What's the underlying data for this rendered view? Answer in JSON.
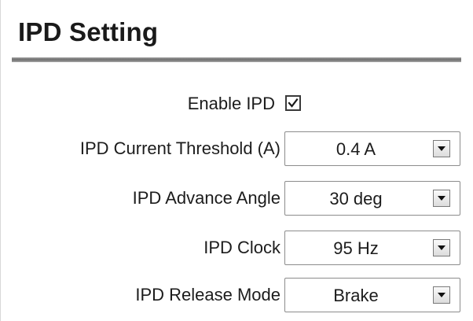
{
  "panel": {
    "title": "IPD Setting"
  },
  "enable": {
    "label": "Enable IPD",
    "checked": true
  },
  "settings": [
    {
      "label": "IPD Current Threshold (A)",
      "value": "0.4 A"
    },
    {
      "label": "IPD Advance Angle",
      "value": "30 deg"
    },
    {
      "label": "IPD Clock",
      "value": "95 Hz"
    },
    {
      "label": "IPD Release Mode",
      "value": "Brake"
    }
  ],
  "icons": {
    "checkbox": "check-icon",
    "dropdown": "chevron-down-icon"
  }
}
